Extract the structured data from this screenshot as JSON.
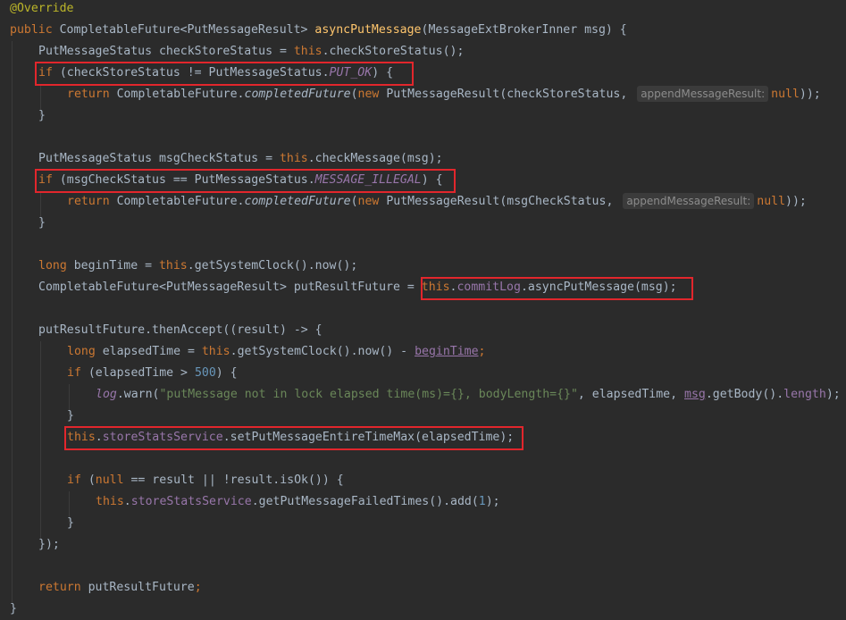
{
  "code": {
    "annotation": "@Override",
    "sig_public": "public",
    "sig_ret": " CompletableFuture<PutMessageResult> ",
    "sig_name": "asyncPutMessage",
    "sig_params": "(MessageExtBrokerInner msg) {",
    "l2_a": "PutMessageStatus checkStoreStatus = ",
    "l2_this": "this",
    "l2_b": ".checkStoreStatus();",
    "l3_if": "if",
    "l3_a": " (checkStoreStatus != PutMessageStatus.",
    "l3_const": "PUT_OK",
    "l3_b": ") {",
    "l4_return": "return",
    "l4_a": " CompletableFuture.",
    "l4_meth": "completedFuture",
    "l4_b": "(",
    "l4_new": "new",
    "l4_c": " PutMessageResult(checkStoreStatus, ",
    "l4_hint": "appendMessageResult:",
    "l4_null": "null",
    "l4_d": "));",
    "brace_close": "}",
    "l7_a": "PutMessageStatus msgCheckStatus = ",
    "l7_this": "this",
    "l7_b": ".checkMessage(msg);",
    "l8_if": "if",
    "l8_a": " (msgCheckStatus == PutMessageStatus.",
    "l8_const": "MESSAGE_ILLEGAL",
    "l8_b": ") {",
    "l9_return": "return",
    "l9_a": " CompletableFuture.",
    "l9_meth": "completedFuture",
    "l9_b": "(",
    "l9_new": "new",
    "l9_c": " PutMessageResult(msgCheckStatus, ",
    "l9_hint": "appendMessageResult:",
    "l9_null": "null",
    "l9_d": "));",
    "l12_long": "long",
    "l12_a": " beginTime = ",
    "l12_this": "this",
    "l12_b": ".getSystemClock().now();",
    "l13_a": "CompletableFuture<PutMessageResult> putResultFuture = ",
    "l13_this": "this",
    "l13_dot": ".",
    "l13_field": "commitLog",
    "l13_b": ".asyncPutMessage(msg);",
    "l15_a": "putResultFuture.thenAccept((result) -> {",
    "l16_long": "long",
    "l16_a": " elapsedTime = ",
    "l16_this": "this",
    "l16_b": ".getSystemClock().now() - ",
    "l16_var": "beginTime",
    "l16_semi": ";",
    "l17_if": "if",
    "l17_a": " (elapsedTime > ",
    "l17_num": "500",
    "l17_b": ") {",
    "l18_log": "log",
    "l18_a": ".warn(",
    "l18_str": "\"putMessage not in lock elapsed time(ms)={}, bodyLength={}\"",
    "l18_b": ", elapsedTime, ",
    "l18_msg": "msg",
    "l18_c": ".getBody().",
    "l18_len": "length",
    "l18_d": ");",
    "l20_this": "this",
    "l20_dot": ".",
    "l20_field": "storeStatsService",
    "l20_a": ".setPutMessageEntireTimeMax(elapsedTime);",
    "l22_if": "if",
    "l22_a": " (",
    "l22_null": "null",
    "l22_b": " == result || !result.isOk()) {",
    "l23_this": "this",
    "l23_dot": ".",
    "l23_field": "storeStatsService",
    "l23_a": ".getPutMessageFailedTimes().add(",
    "l23_num": "1",
    "l23_b": ");",
    "l25_a": "});",
    "l27_return": "return",
    "l27_a": " putResultFuture",
    "l27_semi": ";",
    "l28_a": "}"
  }
}
